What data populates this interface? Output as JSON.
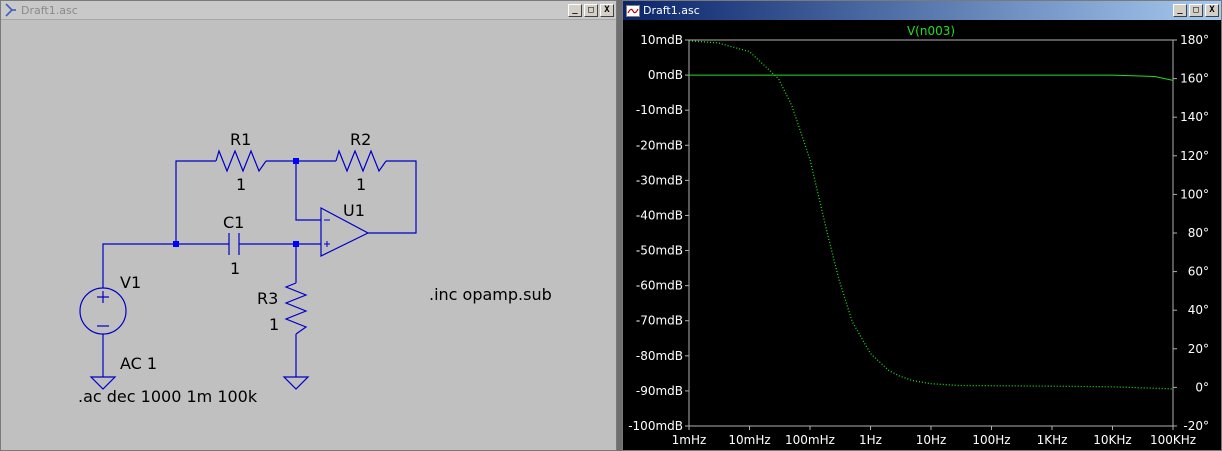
{
  "schematic_window": {
    "title": "Draft1.asc",
    "buttons": {
      "minimize": "_",
      "maximize": "□",
      "close": "X"
    }
  },
  "plot_window": {
    "title": "Draft1.asc",
    "buttons": {
      "minimize": "_",
      "maximize": "□",
      "close": "X"
    }
  },
  "schematic": {
    "components": {
      "R1": {
        "ref": "R1",
        "value": "1"
      },
      "R2": {
        "ref": "R2",
        "value": "1"
      },
      "R3": {
        "ref": "R3",
        "value": "1"
      },
      "C1": {
        "ref": "C1",
        "value": "1"
      },
      "U1": {
        "ref": "U1"
      },
      "V1": {
        "ref": "V1",
        "value": "AC 1"
      }
    },
    "directives": {
      "ac": ".ac dec 1000 1m 100k",
      "include": ".inc opamp.sub"
    },
    "wire_color": "#0000c8"
  },
  "chart_data": {
    "type": "line",
    "title": "V(n003)",
    "xscale": "log",
    "xlim": [
      0.001,
      100000
    ],
    "x_ticks": [
      "1mHz",
      "10mHz",
      "100mHz",
      "1Hz",
      "10Hz",
      "100Hz",
      "1KHz",
      "10KHz",
      "100KHz"
    ],
    "y_left_ticks": [
      "10mdB",
      "0mdB",
      "-10mdB",
      "-20mdB",
      "-30mdB",
      "-40mdB",
      "-50mdB",
      "-60mdB",
      "-70mdB",
      "-80mdB",
      "-90mdB",
      "-100mdB"
    ],
    "ylim_left": [
      -100,
      10
    ],
    "y_right_ticks": [
      "180°",
      "160°",
      "140°",
      "120°",
      "100°",
      "80°",
      "60°",
      "40°",
      "20°",
      "0°",
      "-20°"
    ],
    "ylim_right": [
      -20,
      180
    ],
    "grid": false,
    "series": [
      {
        "name": "V(n003)",
        "axis": "left",
        "style": "solid",
        "color": "#22dd22",
        "x": [
          0.001,
          0.01,
          0.1,
          1,
          10,
          100,
          1000,
          10000,
          50000,
          100000
        ],
        "y": [
          0.0,
          0.0,
          0.0,
          0.0,
          0.0,
          0.0,
          0.0,
          0.0,
          -0.4,
          -1.5
        ]
      },
      {
        "name": "",
        "axis": "right",
        "style": "dotted",
        "color": "#22dd22",
        "x": [
          0.001,
          0.003,
          0.01,
          0.03,
          0.05,
          0.1,
          0.2,
          0.3,
          0.5,
          1,
          2,
          3,
          5,
          10,
          30,
          100,
          1000,
          10000,
          100000
        ],
        "y": [
          179.6,
          178.5,
          174,
          160,
          146,
          118,
          78,
          56,
          34,
          17.5,
          8.8,
          5.9,
          3.5,
          1.9,
          1.0,
          0.9,
          0.6,
          0.3,
          -0.8
        ]
      }
    ]
  }
}
